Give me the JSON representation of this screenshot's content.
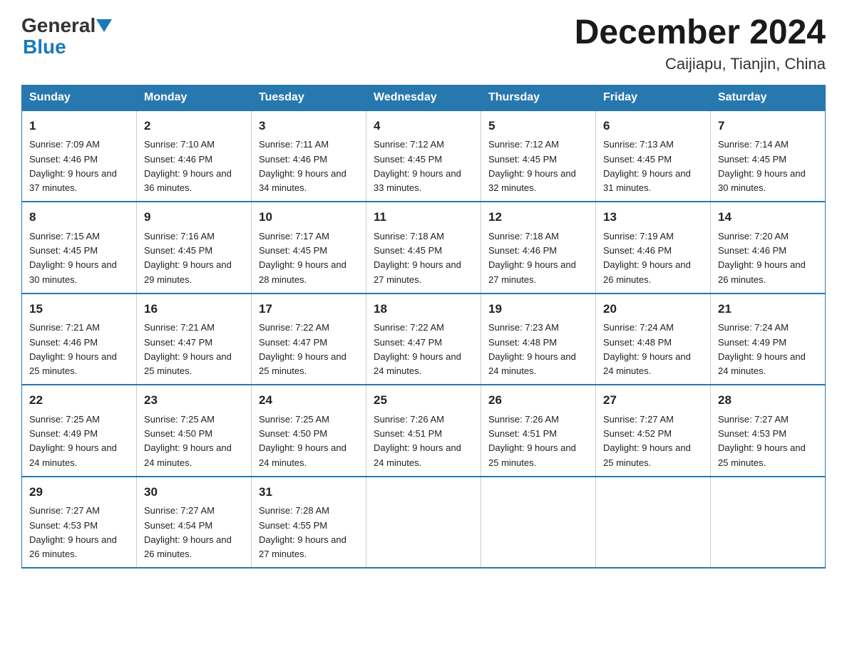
{
  "header": {
    "logo_general": "General",
    "logo_blue": "Blue",
    "title": "December 2024",
    "subtitle": "Caijiapu, Tianjin, China"
  },
  "weekdays": [
    "Sunday",
    "Monday",
    "Tuesday",
    "Wednesday",
    "Thursday",
    "Friday",
    "Saturday"
  ],
  "weeks": [
    [
      {
        "day": "1",
        "sunrise": "7:09 AM",
        "sunset": "4:46 PM",
        "daylight": "9 hours and 37 minutes."
      },
      {
        "day": "2",
        "sunrise": "7:10 AM",
        "sunset": "4:46 PM",
        "daylight": "9 hours and 36 minutes."
      },
      {
        "day": "3",
        "sunrise": "7:11 AM",
        "sunset": "4:46 PM",
        "daylight": "9 hours and 34 minutes."
      },
      {
        "day": "4",
        "sunrise": "7:12 AM",
        "sunset": "4:45 PM",
        "daylight": "9 hours and 33 minutes."
      },
      {
        "day": "5",
        "sunrise": "7:12 AM",
        "sunset": "4:45 PM",
        "daylight": "9 hours and 32 minutes."
      },
      {
        "day": "6",
        "sunrise": "7:13 AM",
        "sunset": "4:45 PM",
        "daylight": "9 hours and 31 minutes."
      },
      {
        "day": "7",
        "sunrise": "7:14 AM",
        "sunset": "4:45 PM",
        "daylight": "9 hours and 30 minutes."
      }
    ],
    [
      {
        "day": "8",
        "sunrise": "7:15 AM",
        "sunset": "4:45 PM",
        "daylight": "9 hours and 30 minutes."
      },
      {
        "day": "9",
        "sunrise": "7:16 AM",
        "sunset": "4:45 PM",
        "daylight": "9 hours and 29 minutes."
      },
      {
        "day": "10",
        "sunrise": "7:17 AM",
        "sunset": "4:45 PM",
        "daylight": "9 hours and 28 minutes."
      },
      {
        "day": "11",
        "sunrise": "7:18 AM",
        "sunset": "4:45 PM",
        "daylight": "9 hours and 27 minutes."
      },
      {
        "day": "12",
        "sunrise": "7:18 AM",
        "sunset": "4:46 PM",
        "daylight": "9 hours and 27 minutes."
      },
      {
        "day": "13",
        "sunrise": "7:19 AM",
        "sunset": "4:46 PM",
        "daylight": "9 hours and 26 minutes."
      },
      {
        "day": "14",
        "sunrise": "7:20 AM",
        "sunset": "4:46 PM",
        "daylight": "9 hours and 26 minutes."
      }
    ],
    [
      {
        "day": "15",
        "sunrise": "7:21 AM",
        "sunset": "4:46 PM",
        "daylight": "9 hours and 25 minutes."
      },
      {
        "day": "16",
        "sunrise": "7:21 AM",
        "sunset": "4:47 PM",
        "daylight": "9 hours and 25 minutes."
      },
      {
        "day": "17",
        "sunrise": "7:22 AM",
        "sunset": "4:47 PM",
        "daylight": "9 hours and 25 minutes."
      },
      {
        "day": "18",
        "sunrise": "7:22 AM",
        "sunset": "4:47 PM",
        "daylight": "9 hours and 24 minutes."
      },
      {
        "day": "19",
        "sunrise": "7:23 AM",
        "sunset": "4:48 PM",
        "daylight": "9 hours and 24 minutes."
      },
      {
        "day": "20",
        "sunrise": "7:24 AM",
        "sunset": "4:48 PM",
        "daylight": "9 hours and 24 minutes."
      },
      {
        "day": "21",
        "sunrise": "7:24 AM",
        "sunset": "4:49 PM",
        "daylight": "9 hours and 24 minutes."
      }
    ],
    [
      {
        "day": "22",
        "sunrise": "7:25 AM",
        "sunset": "4:49 PM",
        "daylight": "9 hours and 24 minutes."
      },
      {
        "day": "23",
        "sunrise": "7:25 AM",
        "sunset": "4:50 PM",
        "daylight": "9 hours and 24 minutes."
      },
      {
        "day": "24",
        "sunrise": "7:25 AM",
        "sunset": "4:50 PM",
        "daylight": "9 hours and 24 minutes."
      },
      {
        "day": "25",
        "sunrise": "7:26 AM",
        "sunset": "4:51 PM",
        "daylight": "9 hours and 24 minutes."
      },
      {
        "day": "26",
        "sunrise": "7:26 AM",
        "sunset": "4:51 PM",
        "daylight": "9 hours and 25 minutes."
      },
      {
        "day": "27",
        "sunrise": "7:27 AM",
        "sunset": "4:52 PM",
        "daylight": "9 hours and 25 minutes."
      },
      {
        "day": "28",
        "sunrise": "7:27 AM",
        "sunset": "4:53 PM",
        "daylight": "9 hours and 25 minutes."
      }
    ],
    [
      {
        "day": "29",
        "sunrise": "7:27 AM",
        "sunset": "4:53 PM",
        "daylight": "9 hours and 26 minutes."
      },
      {
        "day": "30",
        "sunrise": "7:27 AM",
        "sunset": "4:54 PM",
        "daylight": "9 hours and 26 minutes."
      },
      {
        "day": "31",
        "sunrise": "7:28 AM",
        "sunset": "4:55 PM",
        "daylight": "9 hours and 27 minutes."
      },
      null,
      null,
      null,
      null
    ]
  ]
}
